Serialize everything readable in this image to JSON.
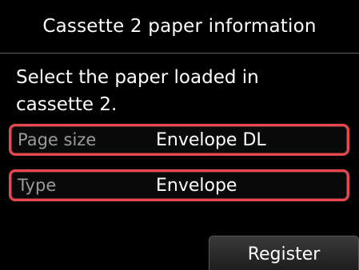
{
  "header": {
    "title": "Cassette 2 paper information"
  },
  "main": {
    "instruction": "Select the paper loaded in cassette 2.",
    "settings": [
      {
        "label": "Page size",
        "value": "Envelope DL"
      },
      {
        "label": "Type",
        "value": "Envelope"
      }
    ]
  },
  "footer": {
    "register_label": "Register"
  },
  "colors": {
    "background": "#000000",
    "highlight_border": "#e8494f",
    "label_text": "#9a9a9a",
    "value_text": "#ffffff"
  }
}
